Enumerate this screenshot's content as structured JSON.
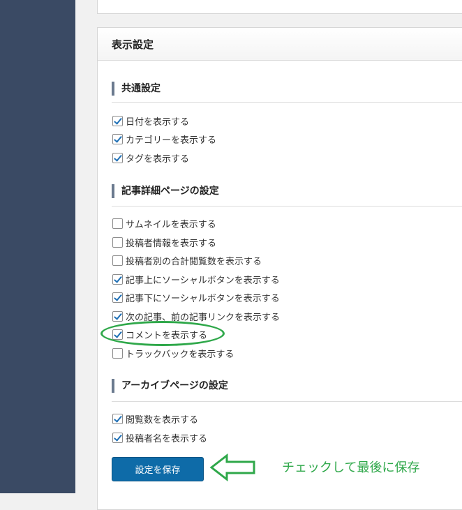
{
  "panel": {
    "title": "表示設定"
  },
  "sections": [
    {
      "title": "共通設定",
      "options": [
        {
          "label": "日付を表示する",
          "checked": true
        },
        {
          "label": "カテゴリーを表示する",
          "checked": true
        },
        {
          "label": "タグを表示する",
          "checked": true
        }
      ]
    },
    {
      "title": "記事詳細ページの設定",
      "options": [
        {
          "label": "サムネイルを表示する",
          "checked": false
        },
        {
          "label": "投稿者情報を表示する",
          "checked": false
        },
        {
          "label": "投稿者別の合計閲覧数を表示する",
          "checked": false
        },
        {
          "label": "記事上にソーシャルボタンを表示する",
          "checked": true
        },
        {
          "label": "記事下にソーシャルボタンを表示する",
          "checked": true
        },
        {
          "label": "次の記事、前の記事リンクを表示する",
          "checked": true
        },
        {
          "label": "コメントを表示する",
          "checked": true
        },
        {
          "label": "トラックバックを表示する",
          "checked": false
        }
      ]
    },
    {
      "title": "アーカイブページの設定",
      "options": [
        {
          "label": "閲覧数を表示する",
          "checked": true
        },
        {
          "label": "投稿者名を表示する",
          "checked": true
        }
      ]
    }
  ],
  "save_button": {
    "label": "設定を保存"
  },
  "annotation": {
    "text": "チェックして最後に保存",
    "color": "#2fa84a"
  },
  "colors": {
    "sidebar": "#3a4a64",
    "button": "#0e6ba8",
    "checkmark": "#1e6fb5",
    "section_accent": "#6b7a8f"
  }
}
